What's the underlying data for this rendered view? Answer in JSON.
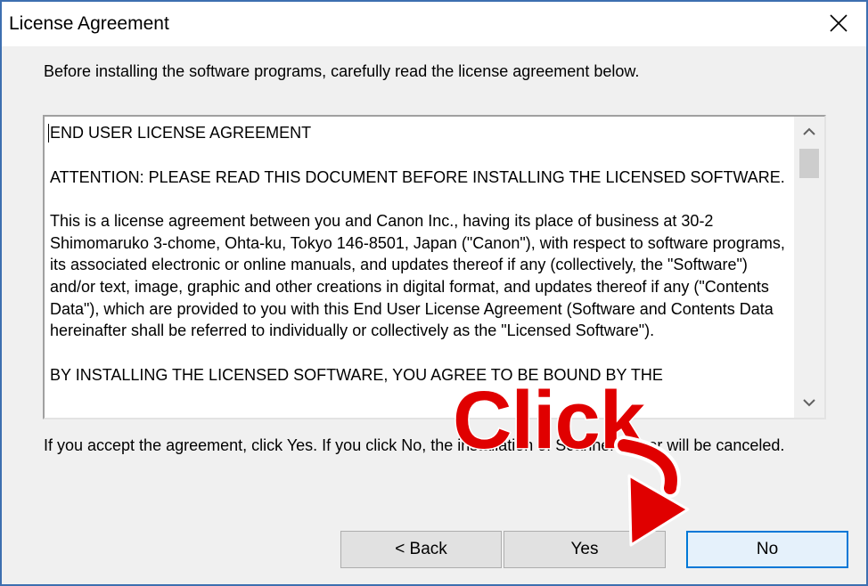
{
  "window": {
    "title": "License Agreement"
  },
  "intro_text": "Before installing the software programs, carefully read the license agreement below.",
  "license": {
    "heading": "END USER LICENSE AGREEMENT",
    "attention": "ATTENTION: PLEASE READ THIS DOCUMENT BEFORE INSTALLING THE LICENSED SOFTWARE.",
    "body": "This is a license agreement between you and Canon Inc., having its place of business at 30-2 Shimomaruko 3-chome, Ohta-ku, Tokyo 146-8501, Japan (\"Canon\"), with respect to software programs, its associated electronic or online manuals, and updates thereof if any (collectively, the \"Software\") and/or text, image, graphic and other creations in digital format, and updates thereof if any (\"Contents Data\"), which are provided to you with this End User License Agreement (Software and Contents Data hereinafter shall be referred to individually or collectively as the \"Licensed Software\").",
    "next_partial": "BY INSTALLING THE LICENSED SOFTWARE, YOU AGREE TO BE BOUND BY THE"
  },
  "accept_text": "If you accept the agreement, click Yes. If you click No, the installation of Scanner Driver will be canceled.",
  "buttons": {
    "back": "< Back",
    "yes": "Yes",
    "no": "No"
  },
  "annotation": {
    "label": "Click",
    "color": "#e00000"
  },
  "icons": {
    "close": "close-icon",
    "scroll_up": "chevron-up-icon",
    "scroll_down": "chevron-down-icon"
  }
}
